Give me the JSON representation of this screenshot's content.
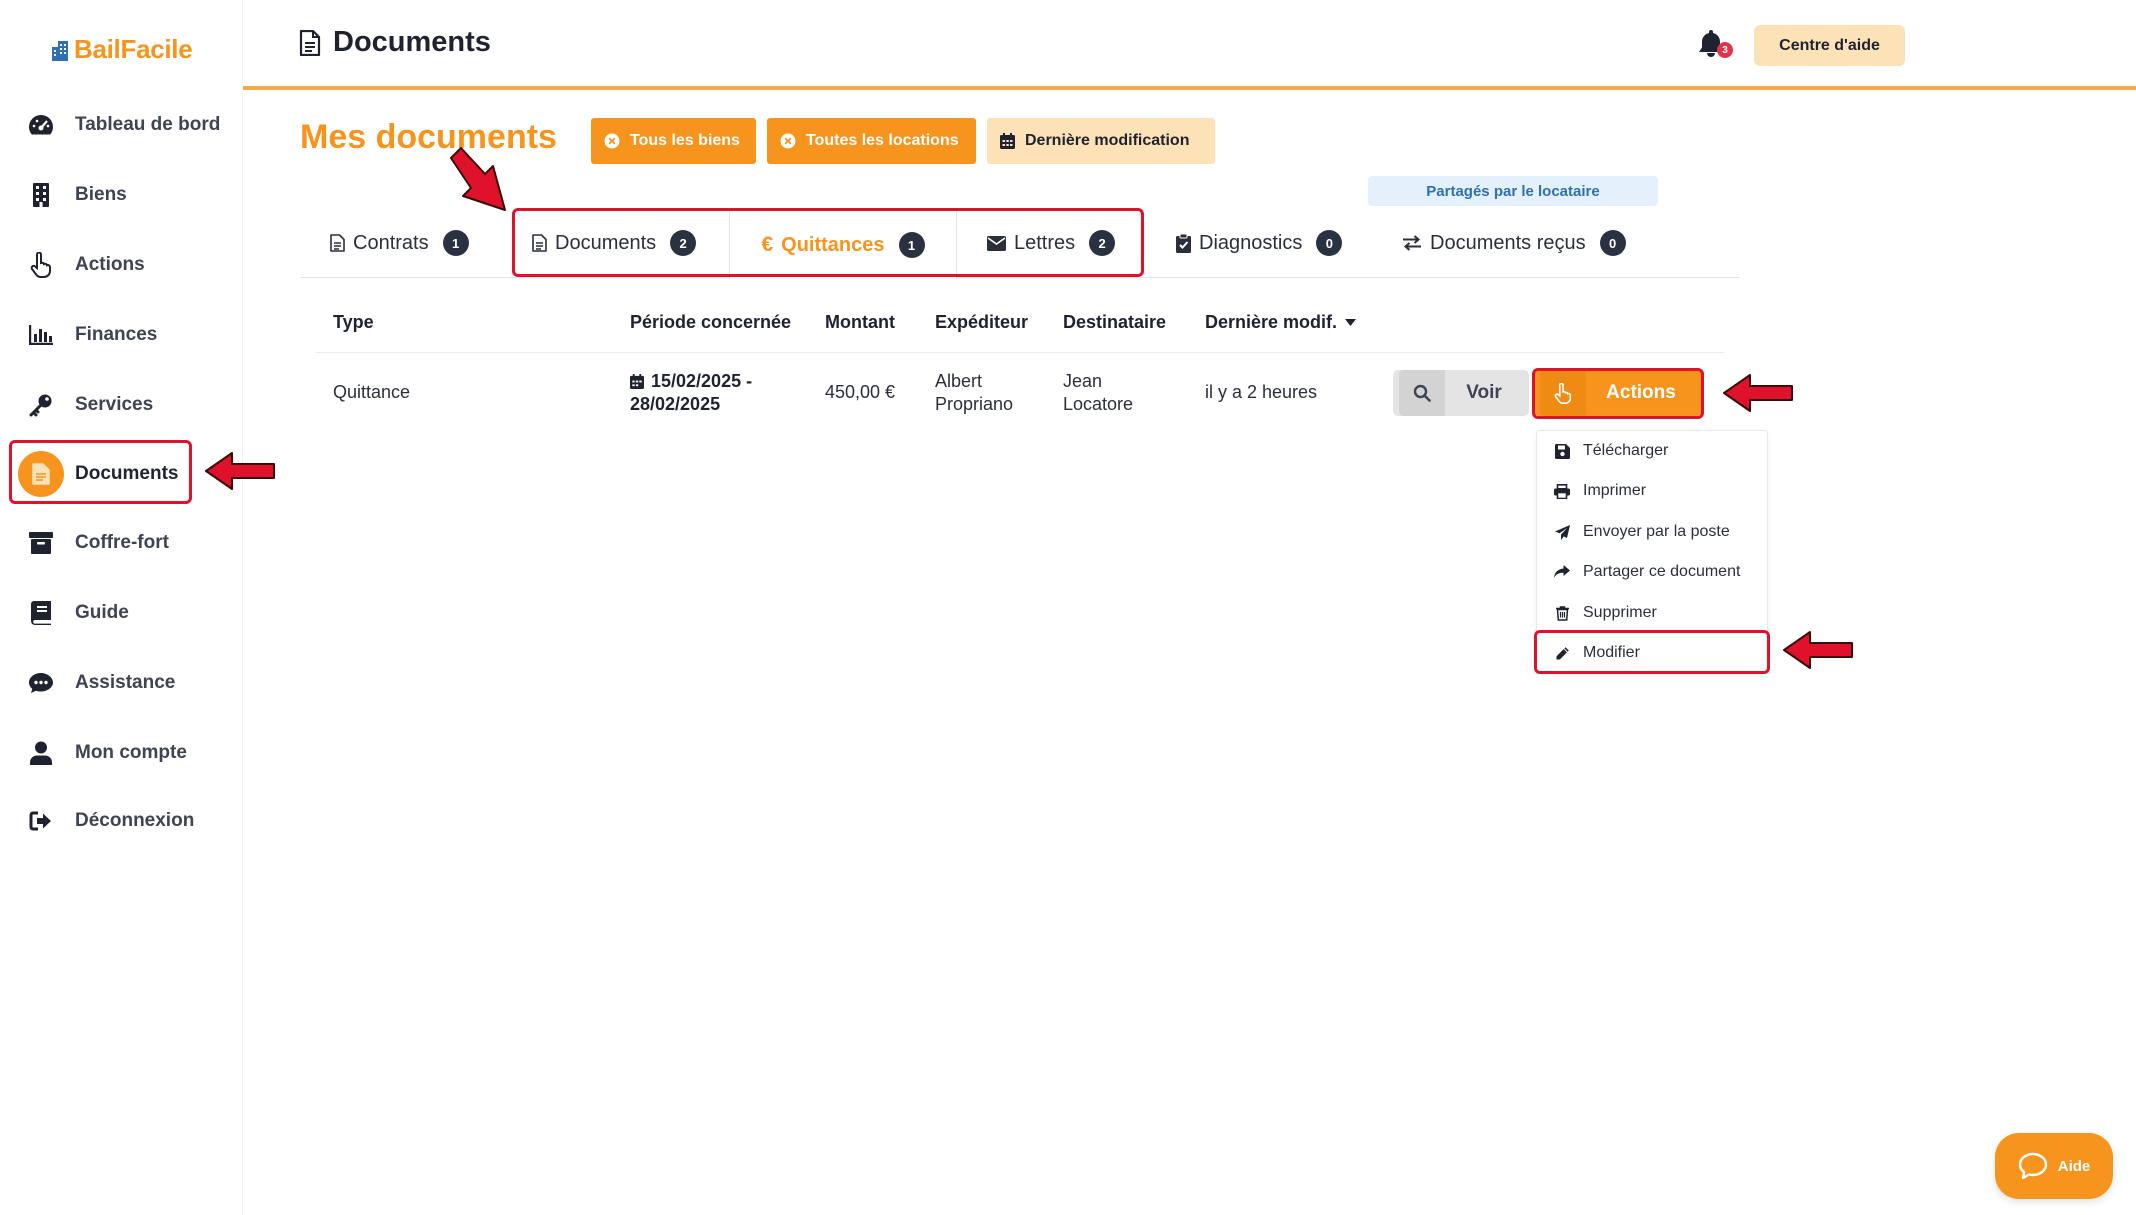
{
  "app": {
    "brand": "BailFacile",
    "accent": "#f7941d"
  },
  "sidebar": {
    "items": [
      {
        "label": "Tableau de bord",
        "icon": "dashboard-gauge-icon"
      },
      {
        "label": "Biens",
        "icon": "building-icon"
      },
      {
        "label": "Actions",
        "icon": "hand-pointer-icon"
      },
      {
        "label": "Finances",
        "icon": "bar-chart-icon"
      },
      {
        "label": "Services",
        "icon": "key-icon"
      },
      {
        "label": "Documents",
        "icon": "document-icon",
        "active": true
      },
      {
        "label": "Coffre-fort",
        "icon": "archive-box-icon"
      },
      {
        "label": "Guide",
        "icon": "book-icon"
      },
      {
        "label": "Assistance",
        "icon": "chat-bubble-icon"
      },
      {
        "label": "Mon compte",
        "icon": "user-icon"
      },
      {
        "label": "Déconnexion",
        "icon": "sign-out-icon"
      }
    ]
  },
  "header": {
    "title": "Documents",
    "help_center": "Centre d'aide",
    "notifications_count": "3"
  },
  "page": {
    "heading": "Mes documents",
    "filters": {
      "all_properties": "Tous les biens",
      "all_rentals": "Toutes les locations",
      "last_modified": "Dernière modification"
    },
    "shared_chip": "Partagés par le locataire"
  },
  "tabs": [
    {
      "label": "Contrats",
      "count": "1",
      "icon": "document-icon"
    },
    {
      "label": "Documents",
      "count": "2",
      "icon": "document-icon"
    },
    {
      "label": "Quittances",
      "count": "1",
      "icon": "euro-icon",
      "active": true
    },
    {
      "label": "Lettres",
      "count": "2",
      "icon": "envelope-icon"
    },
    {
      "label": "Diagnostics",
      "count": "0",
      "icon": "clipboard-check-icon"
    },
    {
      "label": "Documents reçus",
      "count": "0",
      "icon": "exchange-icon"
    }
  ],
  "table": {
    "columns": {
      "type": "Type",
      "period": "Période concernée",
      "amount": "Montant",
      "sender": "Expéditeur",
      "recipient": "Destinataire",
      "last_modified": "Dernière modif."
    },
    "rows": [
      {
        "type": "Quittance",
        "period_line1": "15/02/2025 -",
        "period_line2": "28/02/2025",
        "amount": "450,00 €",
        "sender_line1": "Albert",
        "sender_line2": "Propriano",
        "recipient_line1": "Jean",
        "recipient_line2": "Locatore",
        "last_modified": "il y a 2 heures",
        "view_label": "Voir",
        "actions_label": "Actions"
      }
    ]
  },
  "actions_menu": {
    "items": [
      {
        "label": "Télécharger",
        "icon": "save-floppy-icon"
      },
      {
        "label": "Imprimer",
        "icon": "printer-icon"
      },
      {
        "label": "Envoyer par la poste",
        "icon": "paper-plane-icon"
      },
      {
        "label": "Partager ce document",
        "icon": "share-arrow-icon"
      },
      {
        "label": "Supprimer",
        "icon": "trash-icon"
      },
      {
        "label": "Modifier",
        "icon": "pencil-icon"
      }
    ]
  },
  "help_widget": {
    "label": "Aide"
  },
  "annotation_color": "#e0112b"
}
